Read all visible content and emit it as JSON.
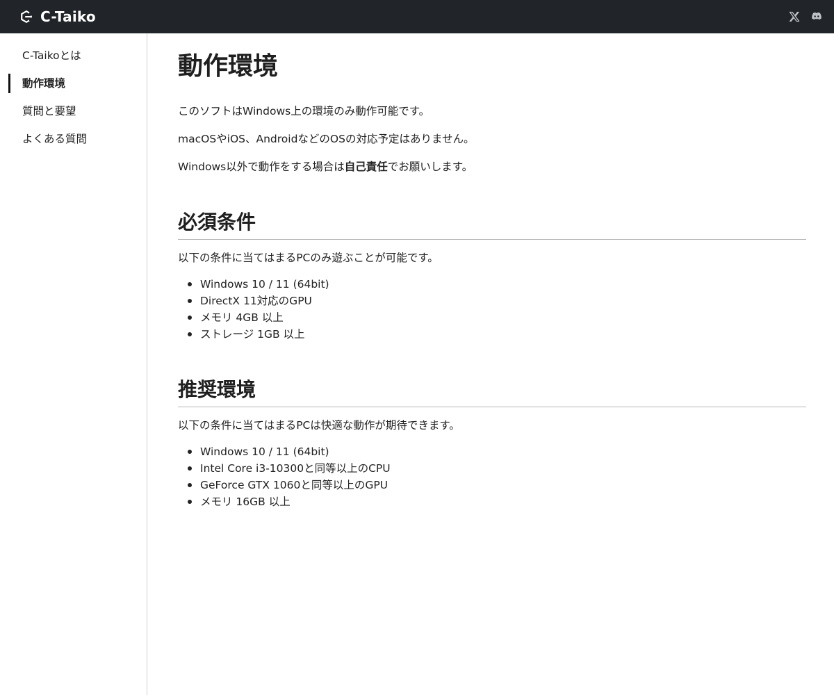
{
  "header": {
    "brand_name": "C-Taiko",
    "logo_icon": "c-taiko-logo-icon",
    "social_links": [
      {
        "name": "X",
        "icon": "x-icon"
      },
      {
        "name": "Discord",
        "icon": "discord-icon"
      }
    ],
    "colors": {
      "background": "#212529",
      "text": "#ffffff",
      "icon": "#bfc3c7"
    }
  },
  "sidebar": {
    "items": [
      {
        "label": "C-Taikoとは",
        "active": false
      },
      {
        "label": "動作環境",
        "active": true
      },
      {
        "label": "質問と要望",
        "active": false
      },
      {
        "label": "よくある質問",
        "active": false
      }
    ]
  },
  "main": {
    "title": "動作環境",
    "intro": [
      "このソフトはWindows上の環境のみ動作可能です。",
      "macOSやiOS、AndroidなどのOSの対応予定はありません。"
    ],
    "note": {
      "before": "Windows以外で動作をする場合は",
      "bold": "自己責任",
      "after": "でお願いします。"
    },
    "sections": [
      {
        "heading": "必須条件",
        "description": "以下の条件に当てはまるPCのみ遊ぶことが可能です。",
        "items": [
          "Windows 10 / 11 (64bit)",
          "DirectX 11対応のGPU",
          "メモリ 4GB 以上",
          "ストレージ 1GB 以上"
        ]
      },
      {
        "heading": "推奨環境",
        "description": "以下の条件に当てはまるPCは快適な動作が期待できます。",
        "items": [
          "Windows 10 / 11 (64bit)",
          "Intel Core i3-10300と同等以上のCPU",
          "GeForce GTX 1060と同等以上のGPU",
          "メモリ 16GB 以上"
        ]
      }
    ]
  }
}
